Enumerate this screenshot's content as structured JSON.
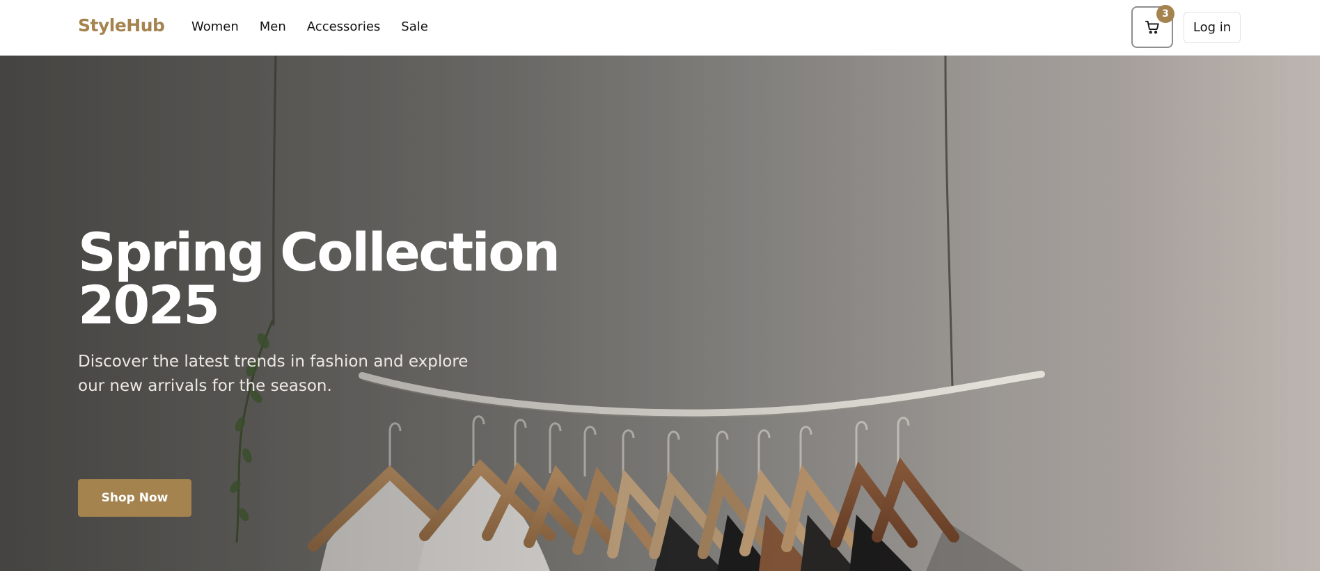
{
  "header": {
    "logo": "StyleHub",
    "nav": [
      "Women",
      "Men",
      "Accessories",
      "Sale"
    ],
    "cart_count": "3",
    "login_label": "Log in"
  },
  "hero": {
    "title_line1": "Spring Collection",
    "title_line2": "2025",
    "subtitle": "Discover the latest trends in fashion and explore our new arrivals for the season.",
    "cta_label": "Shop Now"
  },
  "icons": {
    "cart": "shopping-cart-icon"
  },
  "colors": {
    "brand": "#a4834f",
    "cta": "#a4834f",
    "badge": "#a4834f"
  }
}
